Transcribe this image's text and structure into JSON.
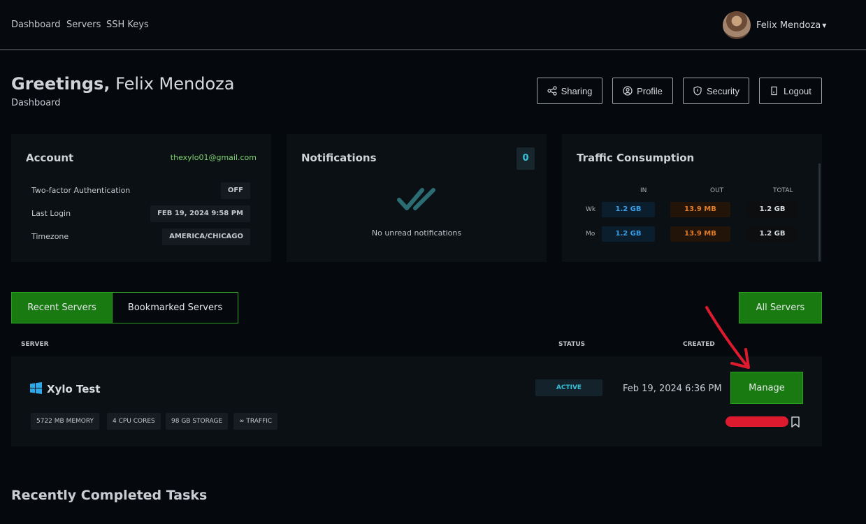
{
  "nav": {
    "links": [
      "Dashboard",
      "Servers",
      "SSH Keys"
    ],
    "user_name": "Felix Mendoza"
  },
  "header": {
    "greeting": "Greetings,",
    "name": "Felix Mendoza",
    "subtitle": "Dashboard",
    "buttons": {
      "sharing": "Sharing",
      "profile": "Profile",
      "security": "Security",
      "logout": "Logout"
    }
  },
  "account": {
    "title": "Account",
    "email": "thexylo01@gmail.com",
    "rows": [
      {
        "label": "Two-factor Authentication",
        "value": "OFF"
      },
      {
        "label": "Last Login",
        "value": "FEB 19, 2024 9:58 PM"
      },
      {
        "label": "Timezone",
        "value": "AMERICA/CHICAGO"
      }
    ]
  },
  "notifications": {
    "title": "Notifications",
    "count": "0",
    "empty_text": "No unread notifications"
  },
  "traffic": {
    "title": "Traffic Consumption",
    "headers": [
      "IN",
      "OUT",
      "TOTAL"
    ],
    "rows": [
      {
        "label": "Wk",
        "in": "1.2 GB",
        "out": "13.9 MB",
        "total": "1.2 GB"
      },
      {
        "label": "Mo",
        "in": "1.2 GB",
        "out": "13.9 MB",
        "total": "1.2 GB"
      }
    ]
  },
  "servers": {
    "tabs": [
      "Recent Servers",
      "Bookmarked Servers"
    ],
    "all_label": "All Servers",
    "columns": [
      "SERVER",
      "STATUS",
      "CREATED"
    ],
    "items": [
      {
        "name": "Xylo Test",
        "status": "ACTIVE",
        "created": "Feb 19, 2024 6:36 PM",
        "specs": [
          "5722 MB MEMORY",
          "4 CPU CORES",
          "98 GB STORAGE",
          "∞ TRAFFIC"
        ],
        "action": "Manage"
      }
    ]
  },
  "tasks": {
    "title": "Recently Completed Tasks"
  },
  "colors": {
    "accent_green": "#1a7a12",
    "status_cyan": "#33c2d9",
    "email_green": "#7dd36f",
    "traffic_in": "#3a9ee6",
    "traffic_out": "#e07c2a",
    "annotation_red": "#dd1a2e"
  }
}
